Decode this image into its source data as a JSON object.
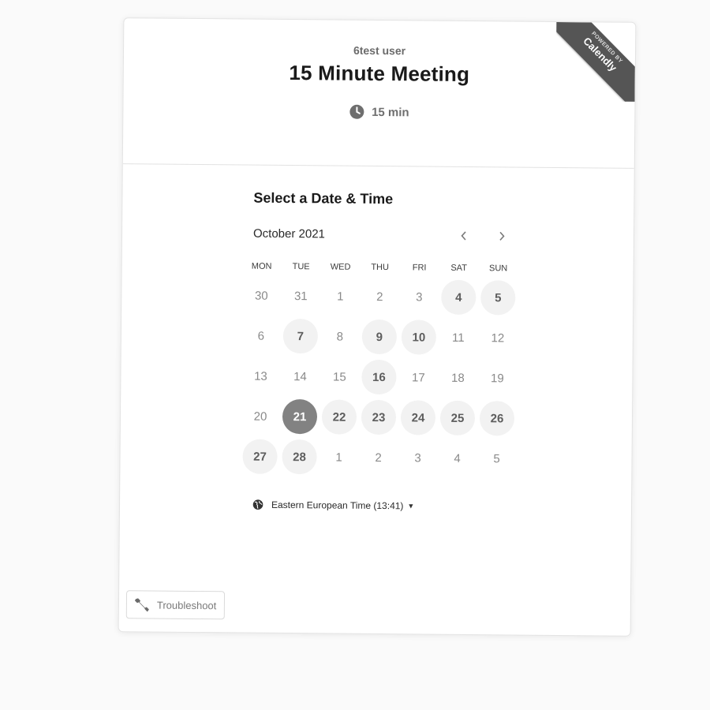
{
  "header": {
    "owner_name": "6test user",
    "event_title": "15 Minute Meeting",
    "duration": "15 min",
    "duration_icon": "clock-icon"
  },
  "badge": {
    "line1": "POWERED BY",
    "line2": "Calendly"
  },
  "picker": {
    "title": "Select a Date & Time",
    "month": "October 2021",
    "prev_icon": "chevron-left-icon",
    "next_icon": "chevron-right-icon",
    "weekdays": [
      "MON",
      "TUE",
      "WED",
      "THU",
      "FRI",
      "SAT",
      "SUN"
    ],
    "days": [
      {
        "label": "30",
        "state": "disabled"
      },
      {
        "label": "31",
        "state": "disabled"
      },
      {
        "label": "1",
        "state": "disabled"
      },
      {
        "label": "2",
        "state": "disabled"
      },
      {
        "label": "3",
        "state": "disabled"
      },
      {
        "label": "4",
        "state": "available"
      },
      {
        "label": "5",
        "state": "available"
      },
      {
        "label": "6",
        "state": "disabled"
      },
      {
        "label": "7",
        "state": "available"
      },
      {
        "label": "8",
        "state": "disabled"
      },
      {
        "label": "9",
        "state": "available"
      },
      {
        "label": "10",
        "state": "available"
      },
      {
        "label": "11",
        "state": "disabled"
      },
      {
        "label": "12",
        "state": "disabled"
      },
      {
        "label": "13",
        "state": "disabled"
      },
      {
        "label": "14",
        "state": "disabled"
      },
      {
        "label": "15",
        "state": "disabled"
      },
      {
        "label": "16",
        "state": "available"
      },
      {
        "label": "17",
        "state": "disabled"
      },
      {
        "label": "18",
        "state": "disabled"
      },
      {
        "label": "19",
        "state": "disabled"
      },
      {
        "label": "20",
        "state": "disabled"
      },
      {
        "label": "21",
        "state": "selected"
      },
      {
        "label": "22",
        "state": "available"
      },
      {
        "label": "23",
        "state": "available"
      },
      {
        "label": "24",
        "state": "available"
      },
      {
        "label": "25",
        "state": "available"
      },
      {
        "label": "26",
        "state": "available"
      },
      {
        "label": "27",
        "state": "available"
      },
      {
        "label": "28",
        "state": "available"
      },
      {
        "label": "1",
        "state": "disabled"
      },
      {
        "label": "2",
        "state": "disabled"
      },
      {
        "label": "3",
        "state": "disabled"
      },
      {
        "label": "4",
        "state": "disabled"
      },
      {
        "label": "5",
        "state": "disabled"
      }
    ],
    "timezone": "Eastern European Time (13:41)",
    "timezone_icon": "globe-icon"
  },
  "footer": {
    "troubleshoot_label": "Troubleshoot",
    "troubleshoot_icon": "wrench-icon"
  },
  "colors": {
    "selected_day": "#828282",
    "available_day_bg": "#f2f2f2",
    "ribbon": "#555555"
  }
}
